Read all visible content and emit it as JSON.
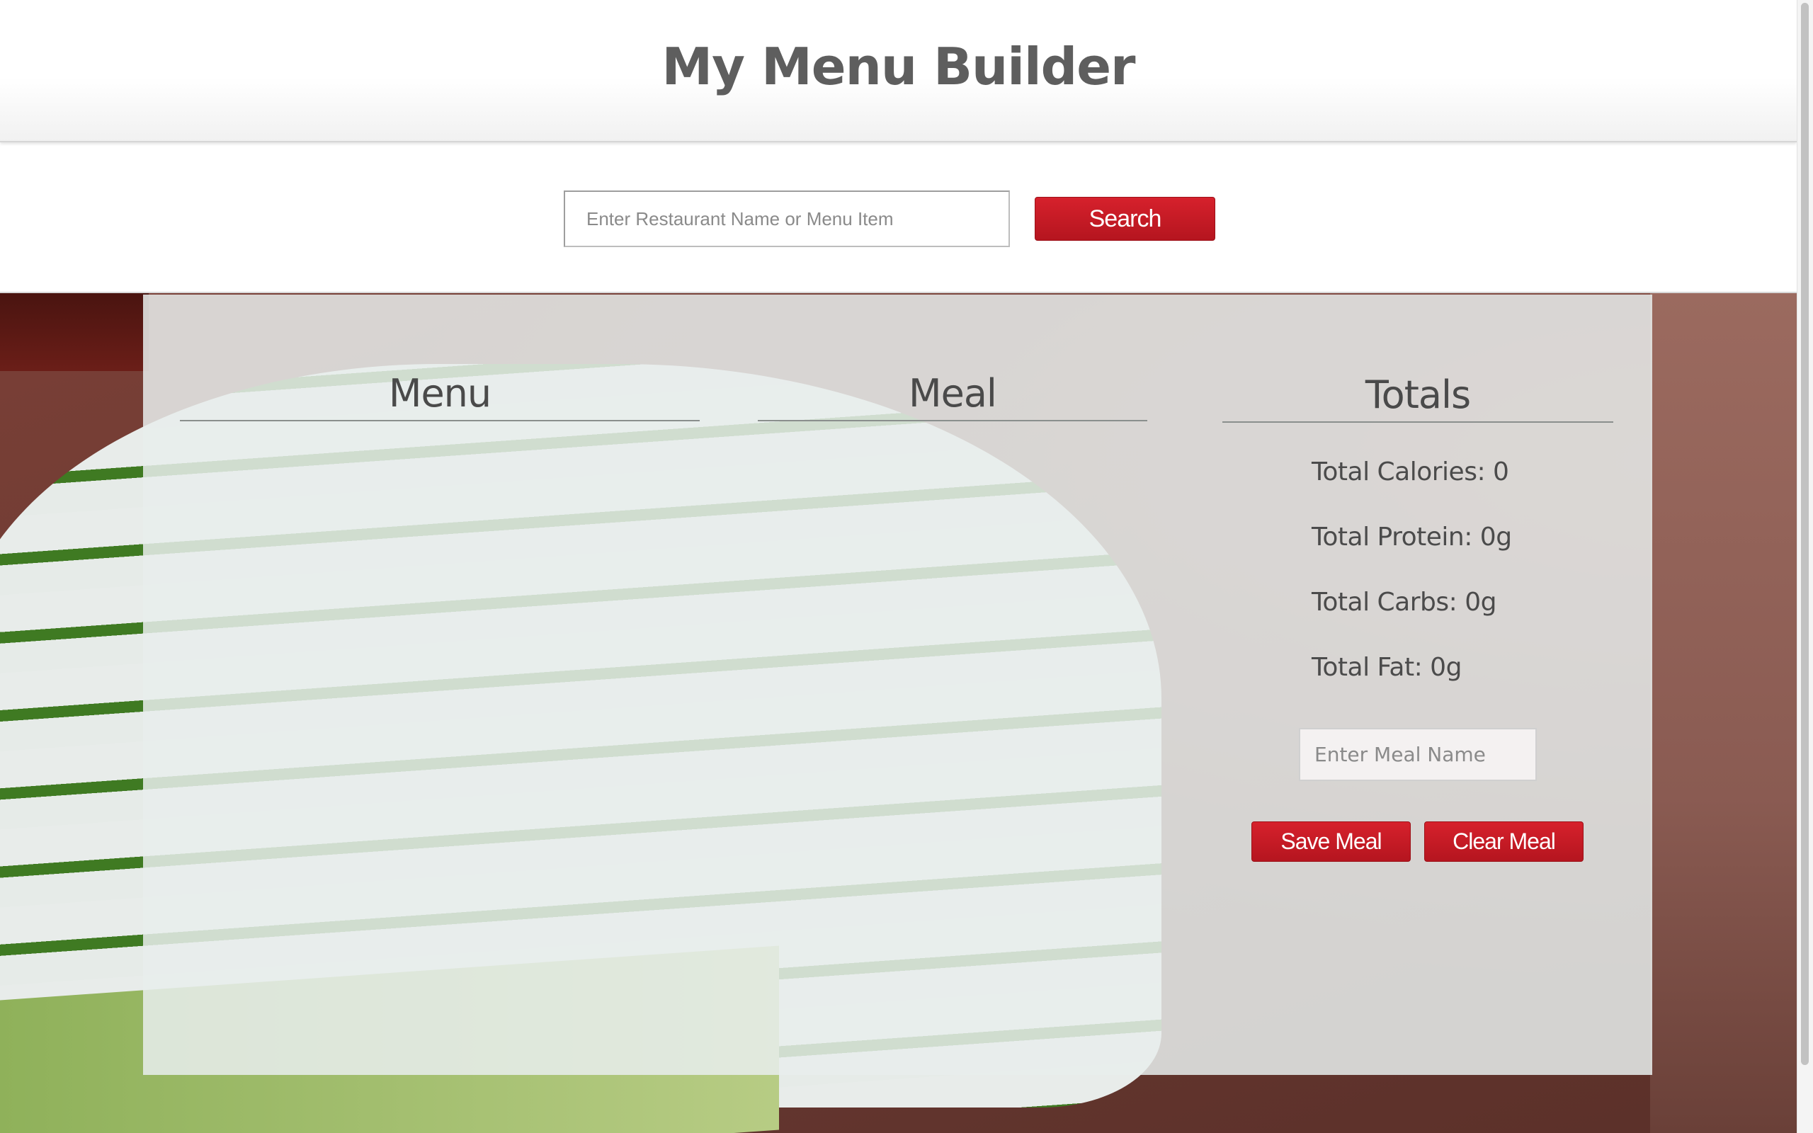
{
  "header": {
    "title": "My Menu Builder"
  },
  "search": {
    "placeholder": "Enter Restaurant Name or Menu Item",
    "button_label": "Search"
  },
  "columns": {
    "menu_heading": "Menu",
    "meal_heading": "Meal",
    "totals_heading": "Totals"
  },
  "totals": {
    "calories": "Total Calories: 0",
    "protein": "Total Protein: 0g",
    "carbs": "Total Carbs: 0g",
    "fat": "Total Fat: 0g"
  },
  "meal_form": {
    "name_placeholder": "Enter Meal Name",
    "save_label": "Save Meal",
    "clear_label": "Clear Meal"
  },
  "colors": {
    "accent_red": "#c41a24",
    "title_gray": "#5e5e5e",
    "panel_bg": "#e8eeec"
  }
}
